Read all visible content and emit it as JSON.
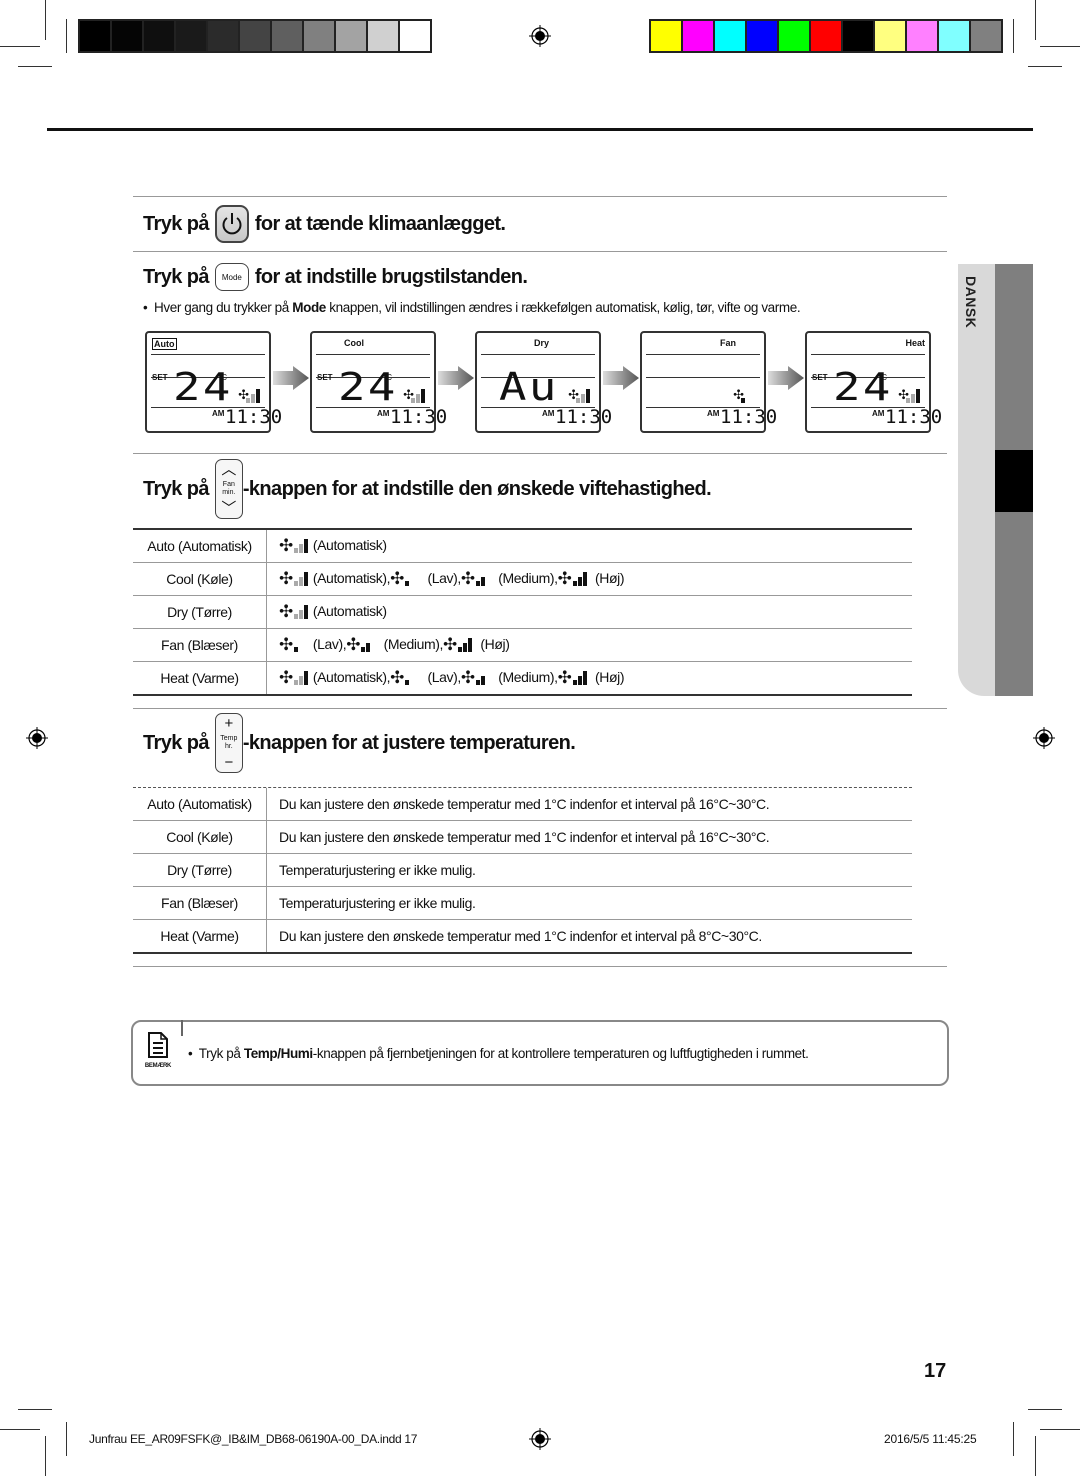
{
  "print_marks": {
    "gray_swatches": [
      "#000000",
      "#050505",
      "#0f0f0f",
      "#1a1a1a",
      "#2b2b2b",
      "#444444",
      "#5f5f5f",
      "#808080",
      "#a3a3a3",
      "#d0d0d0",
      "#ffffff"
    ],
    "color_swatches": [
      "#ffff00",
      "#ff00ff",
      "#00ffff",
      "#0000ff",
      "#00ff00",
      "#ff0000",
      "#000000",
      "#ffff80",
      "#ff80ff",
      "#80ffff",
      "#808080"
    ]
  },
  "side_tab": {
    "label": "DANSK"
  },
  "section1": {
    "prefix": "Tryk på",
    "button_icon": "power-icon",
    "suffix": "for at tænde klimaanlægget."
  },
  "section2": {
    "prefix": "Tryk på",
    "button_label": "Mode",
    "suffix": "for at indstille brugstilstanden.",
    "bullet_pre": "Hver gang du trykker på ",
    "bullet_bold": "Mode",
    "bullet_post": " knappen, vil indstillingen ændres i rækkefølgen automatisk, kølig, tør, vifte og varme.",
    "displays": [
      {
        "mode": "Auto",
        "set": "SET",
        "value": "24",
        "unit": "°C",
        "am": "AM",
        "time": "11:30",
        "fan_level": "auto"
      },
      {
        "mode": "Cool",
        "set": "SET",
        "value": "24",
        "unit": "°C",
        "am": "AM",
        "time": "11:30",
        "fan_level": "auto"
      },
      {
        "mode": "Dry",
        "set": "",
        "value": "Au",
        "unit": "",
        "am": "AM",
        "time": "11:30",
        "fan_level": "auto"
      },
      {
        "mode": "Fan",
        "set": "",
        "value": "",
        "unit": "",
        "am": "AM",
        "time": "11:30",
        "fan_level": "low"
      },
      {
        "mode": "Heat",
        "set": "SET",
        "value": "24",
        "unit": "°C",
        "am": "AM",
        "time": "11:30",
        "fan_level": "auto"
      }
    ]
  },
  "section3": {
    "prefix": "Tryk på",
    "button_top": "Fan",
    "button_bottom": "min.",
    "suffix": "-knappen for at indstille den ønskede viftehastighed.",
    "rows": [
      {
        "mode": "Auto (Automatisk)",
        "options": [
          {
            "level": "auto",
            "label": "(Automatisk)"
          }
        ]
      },
      {
        "mode": "Cool (Køle)",
        "options": [
          {
            "level": "auto",
            "label": "(Automatisk),"
          },
          {
            "level": "low",
            "label": " (Lav),"
          },
          {
            "level": "medium",
            "label": " (Medium),"
          },
          {
            "level": "high",
            "label": " (Høj)"
          }
        ]
      },
      {
        "mode": "Dry (Tørre)",
        "options": [
          {
            "level": "auto",
            "label": "(Automatisk)"
          }
        ]
      },
      {
        "mode": "Fan (Blæser)",
        "options": [
          {
            "level": "low",
            "label": "(Lav),"
          },
          {
            "level": "medium",
            "label": " (Medium),"
          },
          {
            "level": "high",
            "label": " (Høj)"
          }
        ]
      },
      {
        "mode": "Heat (Varme)",
        "options": [
          {
            "level": "auto",
            "label": "(Automatisk),"
          },
          {
            "level": "low",
            "label": " (Lav),"
          },
          {
            "level": "medium",
            "label": " (Medium),"
          },
          {
            "level": "high",
            "label": " (Høj)"
          }
        ]
      }
    ]
  },
  "section4": {
    "prefix": "Tryk på",
    "button_plus": "+",
    "button_label1": "Temp",
    "button_label2": "hr.",
    "button_minus": "−",
    "suffix": "-knappen for at justere temperaturen.",
    "rows": [
      {
        "mode": "Auto (Automatisk)",
        "desc": "Du kan justere den ønskede temperatur med  1°C indenfor et interval på 16°C~30°C."
      },
      {
        "mode": "Cool (Køle)",
        "desc": "Du kan justere den ønskede temperatur med  1°C indenfor et interval på 16°C~30°C."
      },
      {
        "mode": "Dry (Tørre)",
        "desc": "Temperaturjustering er ikke mulig."
      },
      {
        "mode": "Fan (Blæser)",
        "desc": "Temperaturjustering er ikke mulig."
      },
      {
        "mode": "Heat (Varme)",
        "desc": "Du kan justere den ønskede temperatur med  1°C indenfor et interval på 8°C~30°C."
      }
    ]
  },
  "note": {
    "icon_label": "BEMÆRK",
    "pre": "Tryk på ",
    "bold": "Temp/Humi",
    "post": "-knappen på fjernbetjeningen for at kontrollere temperaturen og luftfugtigheden i rummet."
  },
  "page_number": "17",
  "footer": {
    "file": "Junfrau EE_AR09FSFK@_IB&IM_DB68-06190A-00_DA.indd   17",
    "date": "2016/5/5   11:45:25"
  }
}
